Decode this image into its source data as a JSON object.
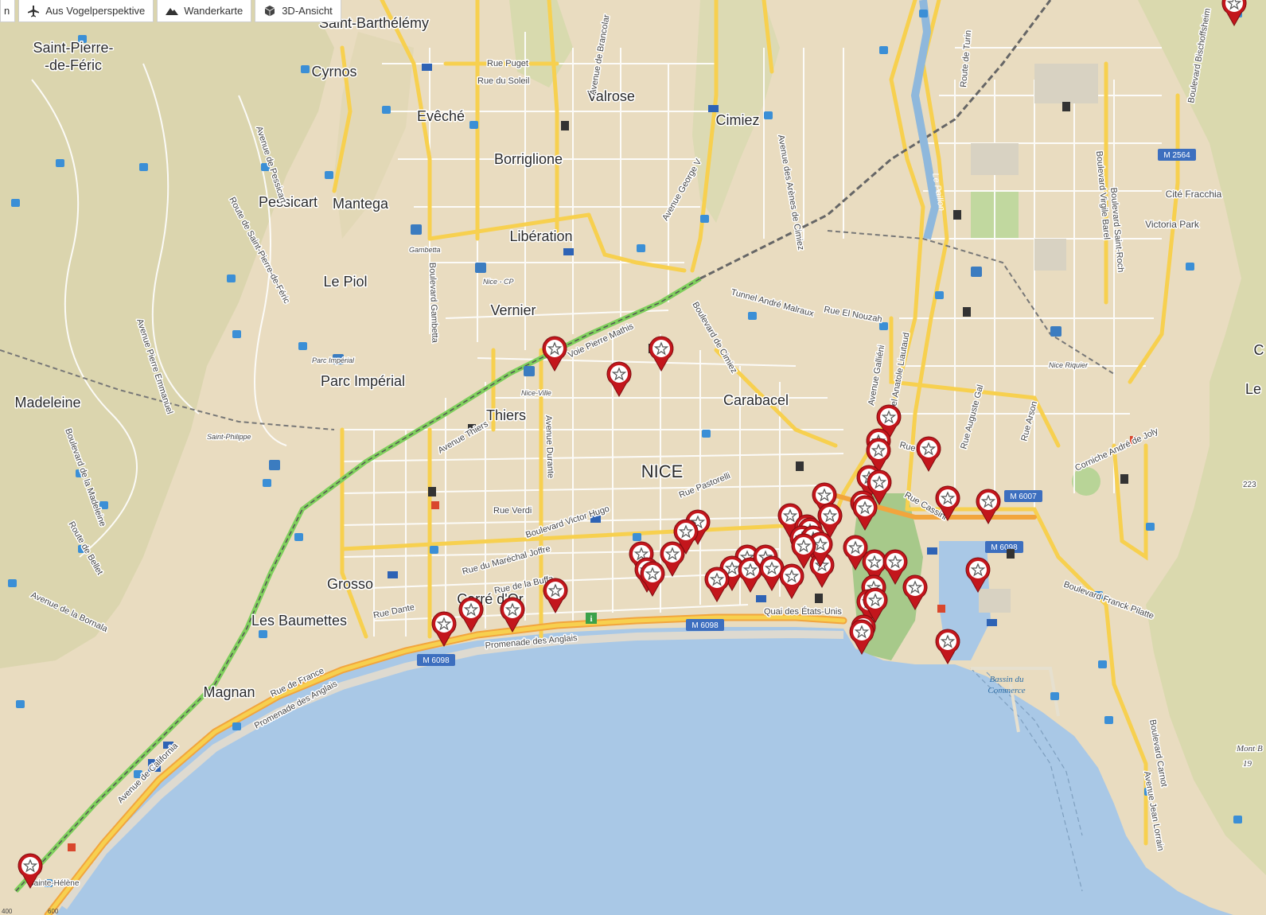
{
  "toolbar": {
    "partial_label": "n",
    "buttons": [
      {
        "label": "Aus Vogelperspektive",
        "icon": "airplane-icon"
      },
      {
        "label": "Wanderkarte",
        "icon": "mountain-icon"
      },
      {
        "label": "3D-Ansicht",
        "icon": "cube-icon"
      }
    ]
  },
  "map": {
    "city_label": "NICE",
    "places": {
      "saint_barthelemy": "Saint-Barthélémy",
      "saint_pierre_1": "Saint-Pierre-",
      "saint_pierre_2": "-de-Féric",
      "cyrnos": "Cyrnos",
      "eveche": "Evêché",
      "valrose": "Valrose",
      "cimiez": "Cimiez",
      "borriglione": "Borriglione",
      "pessicart": "Pessicart",
      "mantega": "Mantega",
      "liberation": "Libération",
      "le_piol": "Le Piol",
      "vernier": "Vernier",
      "parc_imperial": "Parc Impérial",
      "madeleine": "Madeleine",
      "thiers": "Thiers",
      "carabacel": "Carabacel",
      "grosso": "Grosso",
      "carre_dor": "Carré d'Or",
      "les_baumettes": "Les Baumettes",
      "magnan": "Magnan",
      "cite_fracchia": "Cité Fracchia",
      "victoria_park": "Victoria Park",
      "le_partial": "Le",
      "c_partial": "C"
    },
    "streets": {
      "rue_puget": "Rue Puget",
      "rue_du_soleil": "Rue du Soleil",
      "avenue_de_brancolar": "Avenue de Brancolar",
      "route_de_turin": "Route de Turin",
      "boulevard_virgile_barel": "Boulevard Virgile Barel",
      "boulevard_bischoffsheim": "Boulevard Bischoffsheim",
      "avenue_des_arenes": "Avenue des Arènes de Cimiez",
      "avenue_george_v": "Avenue George V",
      "le_paillon": "Le Paillon",
      "boulevard_saint_roch": "Boulevard Saint-Roch",
      "gambetta": "Gambetta",
      "nice_cp": "Nice - CP",
      "boulevard_gambetta": "Boulevard Gambetta",
      "tunnel_malraux": "Tunnel André Malraux",
      "rue_el_nouzah": "Rue El Nouzah",
      "voie_pierre_mathis": "Voie Pierre Mathis",
      "boulevard_de_cimiez": "Boulevard de Cimiez",
      "avenue_gallieni": "Avenue Galliéni",
      "tunnel_liautaud": "Tunnel Anatole Liautaud",
      "rue_auguste_gal": "Rue Auguste Gal",
      "rue_arson": "Rue Arson",
      "nice_riquier": "Nice Riquier",
      "nice_ville": "Nice-Ville",
      "avenue_thiers": "Avenue Thiers",
      "avenue_durante": "Avenue Durante",
      "saint_philippe": "Saint-Philippe",
      "parc_imperial_small": "Parc Impérial",
      "avenue_pierre_emmanuel": "Avenue Pierre Emmanuel",
      "route_saint_pierre": "Route de Saint-Pierre-de-Féric",
      "avenue_de_pessicart": "Avenue de Pessicart",
      "boulevard_madeleine": "Boulevard de la Madeleine",
      "route_de_bellet": "Route de Bellet",
      "avenue_bornala": "Avenue de la Bornala",
      "rue_verdi": "Rue Verdi",
      "rue_pastorelli": "Rue Pastorelli",
      "boulevard_victor_hugo": "Boulevard Victor Hugo",
      "rue_marechal_joffre": "Rue du Maréchal Joffre",
      "rue_de_la_buffa": "Rue de la Buffa",
      "rue_dante": "Rue Dante",
      "promenade_anglais": "Promenade des Anglais",
      "promenade_anglais_2": "Promenade des Anglais",
      "rue_de_france": "Rue de France",
      "quai_etats_unis": "Quai des États-Unis",
      "rue_bo": "Rue Bo",
      "rue_cassini": "Rue Cassini",
      "corniche_andre": "Corniche André de Joly",
      "boulevard_carnot": "Boulevard Carnot",
      "avenue_jean_lorrain": "Avenue Jean Lorrain",
      "boulevard_franck": "Boulevard Franck Pilatte",
      "avenue_california": "Avenue de California",
      "sainte_helene": "Sainte-Hélène",
      "mont_boron": "Mont B",
      "mont_boron_alt": "19",
      "alt_223": "223"
    },
    "roads": {
      "m2564": "M 2564",
      "m6007": "M 6007",
      "m6098_a": "M 6098",
      "m6098_b": "M 6098",
      "m6098_c": "M 6098"
    },
    "water_label_1": "Bassin du",
    "water_label_2": "Commerce",
    "scale_left": "400",
    "scale_right": "600",
    "marker_count": 55
  },
  "colors": {
    "land": "#e9dcc0",
    "sea": "#a9c8e6",
    "green": "#c7d8a5",
    "major_road": "#f7d04f",
    "minor_road": "#ffffff",
    "motorway": "#f2a53d",
    "rail": "#7fcf5c",
    "marker": "#c3161c"
  }
}
